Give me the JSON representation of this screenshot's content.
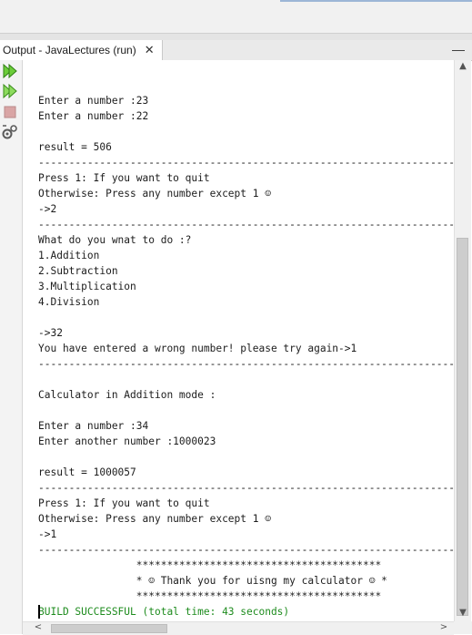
{
  "output_tab": {
    "title": "Output - JavaLectures (run)",
    "close_glyph": "✕"
  },
  "panel": {
    "minimize_glyph": "—"
  },
  "toolbar": {
    "tools": [
      {
        "icon": "rerun-icon"
      },
      {
        "icon": "rerun-with-options-icon"
      },
      {
        "icon": "stop-icon"
      },
      {
        "icon": "settings-icon"
      }
    ]
  },
  "console": {
    "lines": [
      "",
      "Enter a number :23",
      "Enter a number :22",
      "",
      "result = 506",
      "----------------------------------------------------------------------",
      "Press 1: If you want to quit",
      "Otherwise: Press any number except 1 ☺",
      "->2",
      "----------------------------------------------------------------------",
      "What do you wnat to do :?",
      "1.Addition",
      "2.Subtraction",
      "3.Multiplication",
      "4.Division",
      "",
      "->32",
      "You have entered a wrong number! please try again->1",
      "----------------------------------------------------------------------",
      "",
      "Calculator in Addition mode :",
      "",
      "Enter a number :34",
      "Enter another number :1000023",
      "",
      "result = 1000057",
      "----------------------------------------------------------------------",
      "Press 1: If you want to quit",
      "Otherwise: Press any number except 1 ☺",
      "->1",
      "----------------------------------------------------------------------",
      "                ****************************************",
      "                * ☺ Thank you for uisng my calculator ☺ *",
      "                ****************************************",
      "BUILD SUCCESSFUL (total time: 43 seconds)"
    ],
    "build_status_color": "#1e8c1e"
  },
  "scrollbars": {
    "up": "▲",
    "down": "▼",
    "left": "<",
    "right": ">"
  }
}
